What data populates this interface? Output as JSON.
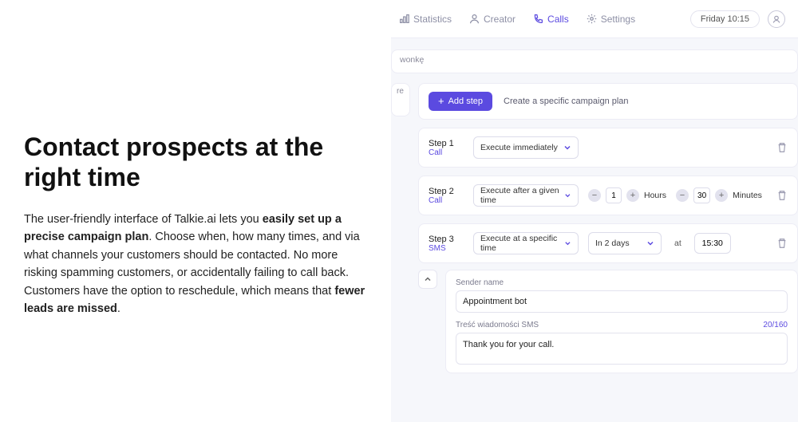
{
  "left": {
    "heading": "Contact prospects at the right time",
    "para_pre": "The user-friendly interface of Talkie.ai lets you ",
    "para_b1": "easily set up a precise campaign plan",
    "para_mid": ". Choose when, how many times, and via what channels your customers should be contacted. No more risking spamming customers, or accidentally failing to call back. Customers have the option to reschedule, which means that ",
    "para_b2": "fewer leads are missed",
    "para_end": "."
  },
  "tabs": {
    "statistics": "Statistics",
    "creator": "Creator",
    "calls": "Calls",
    "settings": "Settings"
  },
  "header": {
    "datetime": "Friday 10:15"
  },
  "stubs": {
    "top": "wonkę",
    "side": "re"
  },
  "add": {
    "button": "Add step",
    "hint": "Create a specific campaign plan"
  },
  "steps": [
    {
      "title": "Step 1",
      "kind": "Call",
      "timing": "Execute immediately"
    },
    {
      "title": "Step 2",
      "kind": "Call",
      "timing": "Execute after a given time",
      "hours_val": "1",
      "hours_lbl": "Hours",
      "min_val": "30",
      "min_lbl": "Minutes"
    },
    {
      "title": "Step 3",
      "kind": "SMS",
      "timing": "Execute at a specific time",
      "when": "In 2 days",
      "at_lbl": "at",
      "time": "15:30"
    }
  ],
  "sms": {
    "sender_lbl": "Sender name",
    "sender_val": "Appointment bot",
    "msg_lbl": "Treść wiadomości SMS",
    "counter": "20/160",
    "msg_val": "Thank you for your call."
  }
}
